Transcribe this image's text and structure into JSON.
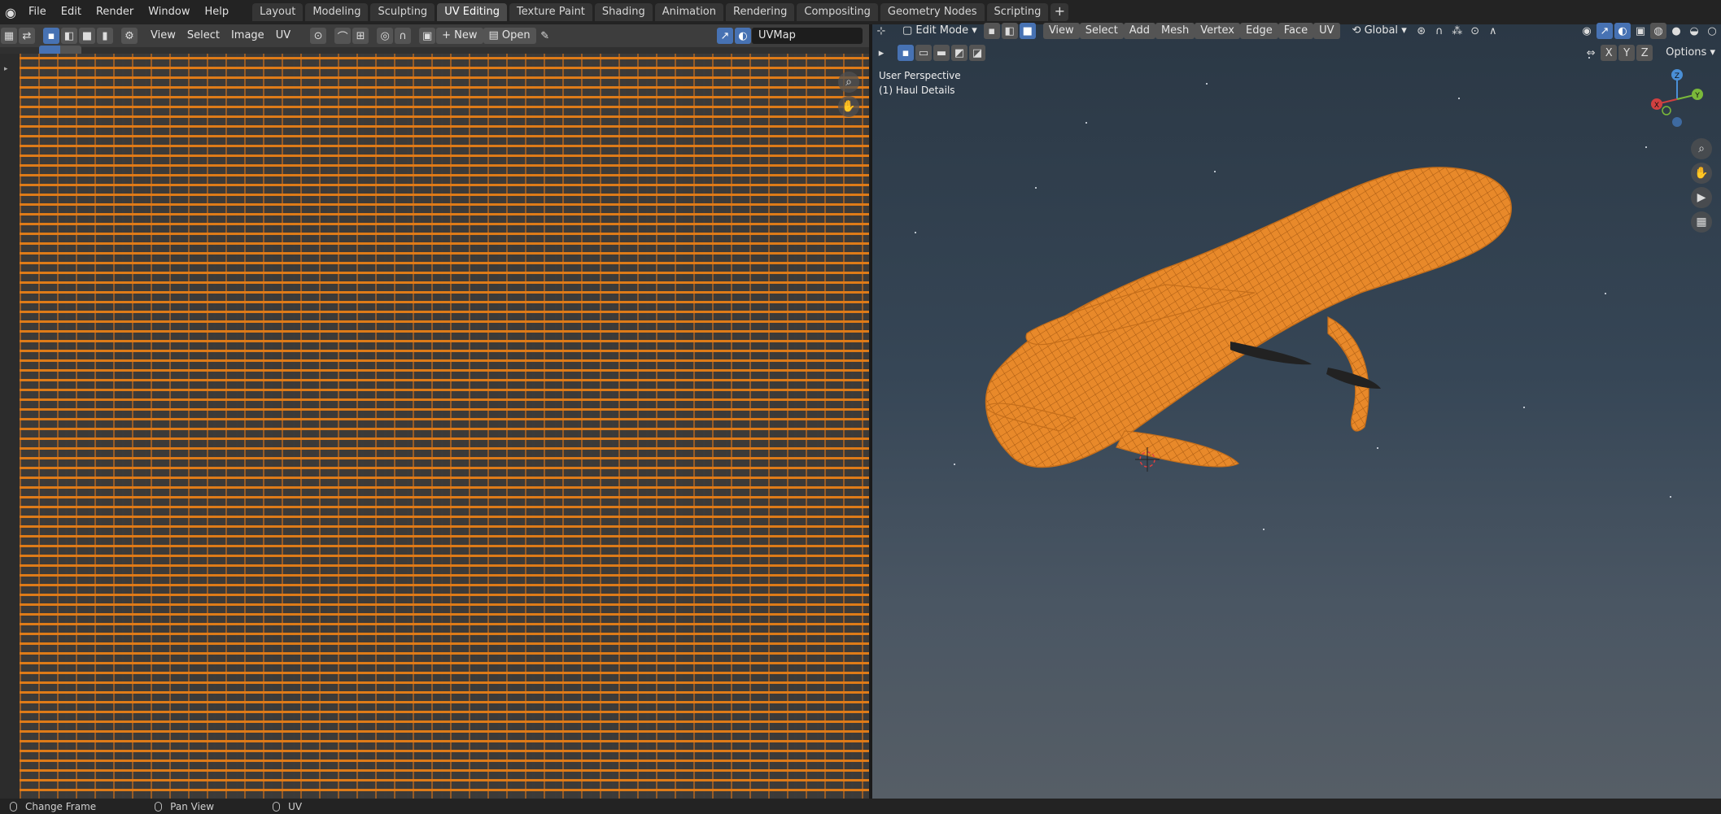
{
  "app": {
    "menus": [
      "File",
      "Edit",
      "Render",
      "Window",
      "Help"
    ],
    "workspaces": [
      "Layout",
      "Modeling",
      "Sculpting",
      "UV Editing",
      "Texture Paint",
      "Shading",
      "Animation",
      "Rendering",
      "Compositing",
      "Geometry Nodes",
      "Scripting"
    ],
    "active_workspace": "UV Editing",
    "add_workspace": "+"
  },
  "uv_editor": {
    "menus": [
      "View",
      "Select",
      "Image",
      "UV"
    ],
    "new_label": "New",
    "open_label": "Open",
    "uvmap_value": "UVMap"
  },
  "viewport": {
    "mode_label": "Edit Mode",
    "menus": [
      "View",
      "Select",
      "Add",
      "Mesh",
      "Vertex",
      "Edge",
      "Face",
      "UV"
    ],
    "orientation": "Global",
    "axes": [
      "X",
      "Y",
      "Z"
    ],
    "options_label": "Options",
    "perspective_text": "User Perspective",
    "object_text": "(1) Haul Details",
    "gizmo_labels": {
      "x": "X",
      "y": "Y",
      "z": "Z"
    }
  },
  "statusbar": {
    "items": [
      "Change Frame",
      "Pan View",
      "UV"
    ]
  },
  "colors": {
    "accent": "#4772b3",
    "mesh_orange": "#e8892a",
    "header_bg": "#3d3d3d"
  }
}
